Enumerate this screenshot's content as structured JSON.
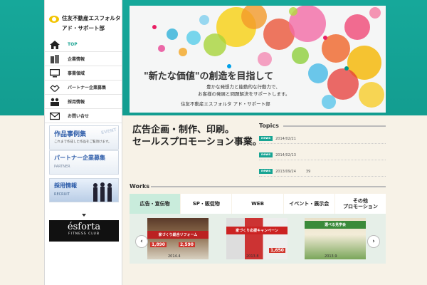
{
  "logo": {
    "line1": "住友不動産エスフォルタ",
    "line2": "アド・サポート部"
  },
  "nav": [
    {
      "label": "TOP",
      "icon": "home-icon"
    },
    {
      "label": "企業情報",
      "icon": "building-icon"
    },
    {
      "label": "事業領域",
      "icon": "monitor-icon"
    },
    {
      "label": "パートナー企業募集",
      "icon": "handshake-icon"
    },
    {
      "label": "採用情報",
      "icon": "people-icon"
    },
    {
      "label": "お問い合せ",
      "icon": "envelope-icon"
    }
  ],
  "side_banners": {
    "works": {
      "title": "作品事例集",
      "sub": "これまで作成した作品をご覧頂けます。",
      "deco": "EVENT"
    },
    "partner": {
      "title": "パートナー企業募集",
      "sub": "PARTNER"
    },
    "recruit": {
      "title": "採用情報",
      "sub": "RECRUIT"
    }
  },
  "esforta": {
    "brand": "ésforta",
    "sub": "FITNESS CLUB"
  },
  "hero": {
    "headline": "\"新たな価値\"の創造を目指して",
    "sub1": "豊かな発想力と能動的な行動力で、",
    "sub2": "お客様の発展と問題解決をサポートします。",
    "company": "住友不動産エスフォルタ アド・サポート部"
  },
  "tagline": {
    "line1": "広告企画・制作、印刷。",
    "line2": "セールスプロモーション事業。"
  },
  "topics": {
    "heading": "Topics",
    "tag": "news",
    "items": [
      {
        "date": "2014/02/21",
        "text": ""
      },
      {
        "date": "2014/02/13",
        "text": ""
      },
      {
        "date": "2013/09/24",
        "text": "39"
      }
    ]
  },
  "works": {
    "heading": "Works",
    "tabs": [
      "広告・宣伝物",
      "SP・販促物",
      "WEB",
      "イベント・展示会",
      "その他\nプロモーション"
    ],
    "prev": "‹",
    "next": "›",
    "thumbs": [
      {
        "band": "家づくり総合リフォーム",
        "price1": "1,890",
        "price2": "2,590",
        "caption": "2014.4"
      },
      {
        "band": "家づくり応援キャンペーン",
        "price1": "1,650",
        "caption": "2013.8"
      },
      {
        "band": "選べる見学会",
        "price1": "",
        "caption": "2013.9"
      }
    ]
  },
  "colors": {
    "teal": "#16a89a",
    "accent": "#17a493",
    "tab_active": "#c9ecdc"
  }
}
